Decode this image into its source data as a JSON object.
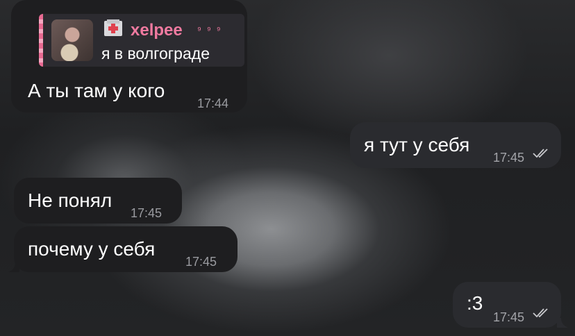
{
  "messages": [
    {
      "direction": "incoming",
      "reply": {
        "icon": "hospital-icon",
        "author": "xelpee",
        "author_suffix": "⁹ ⁹ ⁹",
        "text": "я в волгограде"
      },
      "text": "А ты там у кого",
      "time": "17:44"
    },
    {
      "direction": "outgoing",
      "text": "я тут у себя",
      "time": "17:45",
      "status": "read"
    },
    {
      "direction": "incoming",
      "text": "Не понял",
      "time": "17:45"
    },
    {
      "direction": "incoming",
      "text": "почему у себя",
      "time": "17:45"
    },
    {
      "direction": "outgoing",
      "text": ":3",
      "time": "17:45",
      "status": "read"
    }
  ],
  "colors": {
    "incoming_bubble": "#1e1e20",
    "outgoing_bubble": "#2a2b2f",
    "reply_accent": "#f07aa0",
    "timestamp": "#9a9ba0"
  }
}
